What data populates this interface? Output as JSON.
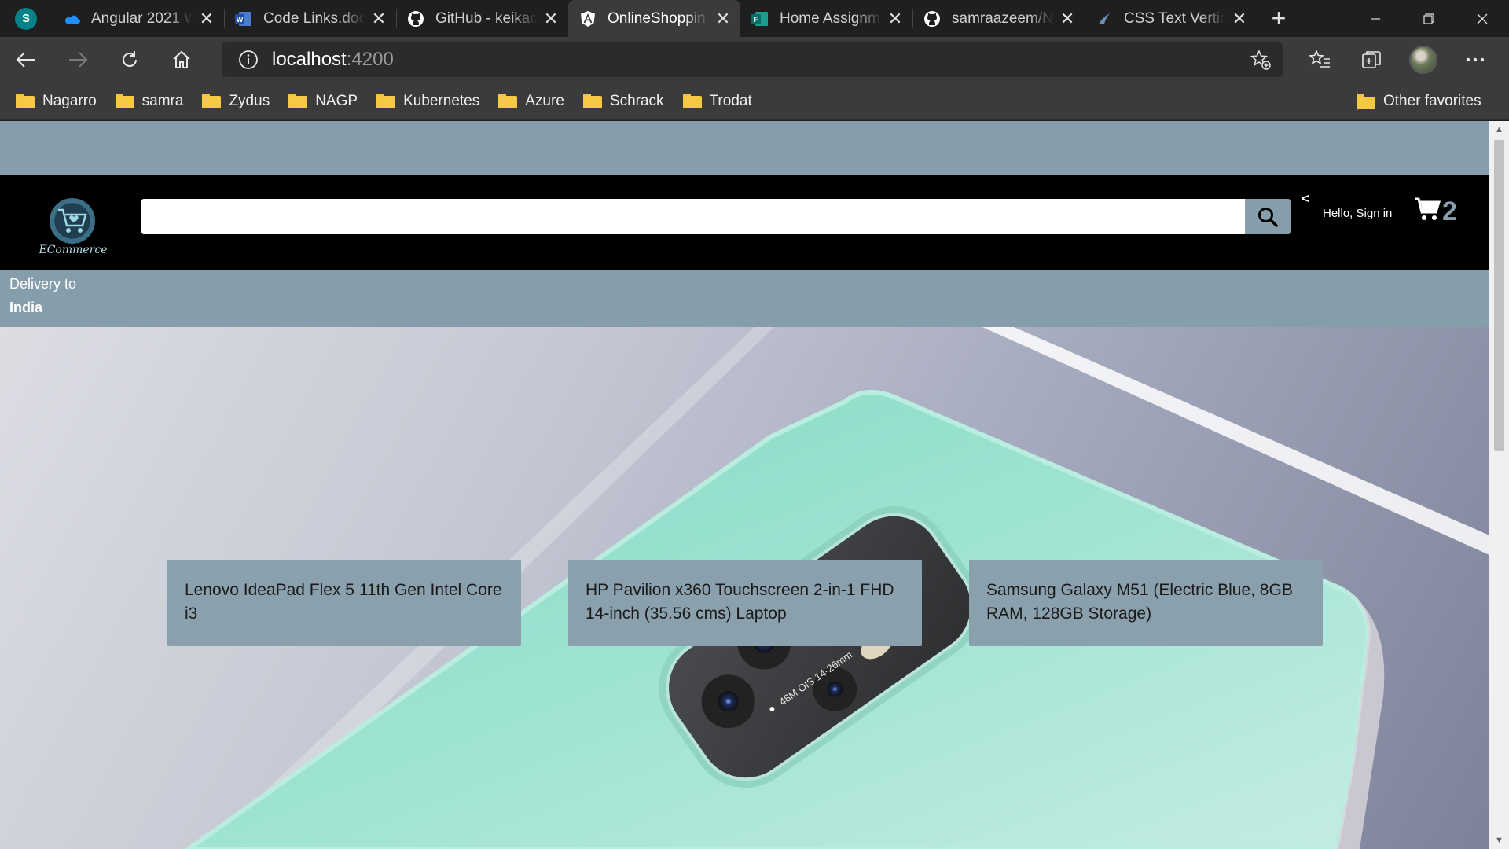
{
  "browser": {
    "tabs": [
      {
        "title": "",
        "icon": "sharepoint-icon"
      },
      {
        "title": "Angular 2021 W",
        "icon": "onedrive-cloud-icon"
      },
      {
        "title": "Code Links.doc",
        "icon": "word-doc-icon"
      },
      {
        "title": "GitHub - keikac",
        "icon": "github-icon"
      },
      {
        "title": "OnlineShoppin",
        "icon": "angular-icon",
        "active": true
      },
      {
        "title": "Home Assignm",
        "icon": "forms-icon"
      },
      {
        "title": "samraazeem/N",
        "icon": "github-icon"
      },
      {
        "title": "CSS Text Vertic",
        "icon": "css-tricks-icon"
      }
    ],
    "address": {
      "host": "localhost",
      "port": ":4200"
    },
    "favorites": [
      "Nagarro",
      "samra",
      "Zydus",
      "NAGP",
      "Kubernetes",
      "Azure",
      "Schrack",
      "Trodat"
    ],
    "other_favorites": "Other favorites"
  },
  "page": {
    "logo_text": "ECommerce",
    "search": {
      "value": "",
      "placeholder": ""
    },
    "header_arrow": "<",
    "sign_in": "Hello, Sign in",
    "cart_count": "2",
    "delivery": {
      "label": "Delivery to",
      "country": "India"
    },
    "hero_camera_text": "48M OIS 14-26mm",
    "products": [
      {
        "title": "Lenovo IdeaPad Flex 5 11th Gen Intel Core i3"
      },
      {
        "title": "HP Pavilion x360 Touchscreen 2-in-1 FHD 14-inch (35.56 cms) Laptop"
      },
      {
        "title": "Samsung Galaxy M51 (Electric Blue, 8GB RAM, 128GB Storage)"
      }
    ]
  },
  "colors": {
    "accent": "#869eab",
    "header": "#000000",
    "phone_body": "#8fdcc8"
  }
}
